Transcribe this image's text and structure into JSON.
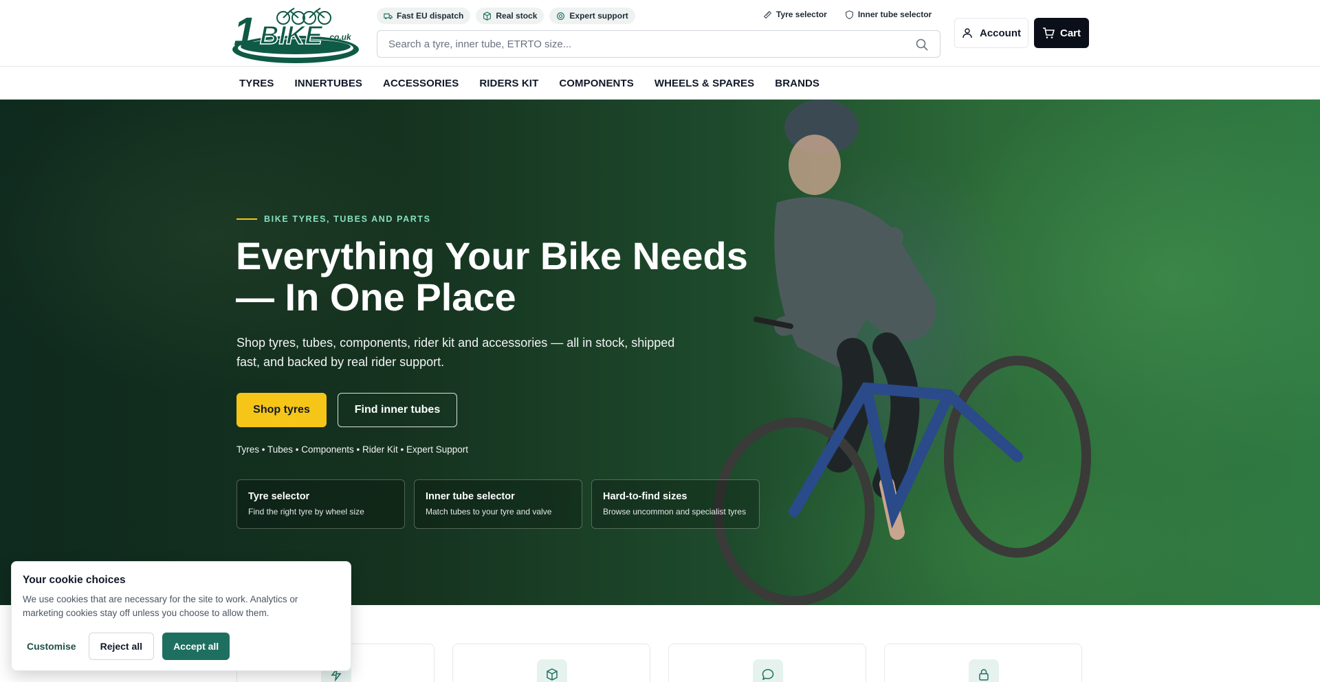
{
  "brand": {
    "logo_text": "1BIKE",
    "logo_suffix": ".co.uk",
    "accent": "#1f6f61",
    "cta_yellow": "#f5c518"
  },
  "badges": [
    {
      "label": "Fast EU dispatch",
      "icon": "truck-icon"
    },
    {
      "label": "Real stock",
      "icon": "box-icon"
    },
    {
      "label": "Expert support",
      "icon": "support-icon"
    }
  ],
  "top_links": [
    {
      "label": "Tyre selector",
      "icon": "ruler-icon"
    },
    {
      "label": "Inner tube selector",
      "icon": "shield-icon"
    }
  ],
  "search": {
    "placeholder": "Search a tyre, inner tube, ETRTO size...",
    "value": ""
  },
  "account": {
    "label": "Account"
  },
  "cart": {
    "label": "Cart"
  },
  "nav": [
    "TYRES",
    "INNERTUBES",
    "ACCESSORIES",
    "RIDERS KIT",
    "COMPONENTS",
    "WHEELS & SPARES",
    "BRANDS"
  ],
  "hero": {
    "eyebrow": "BIKE TYRES, TUBES AND PARTS",
    "title_line1": "Everything Your Bike Needs",
    "title_line2": "— In One Place",
    "subtitle": "Shop tyres, tubes, components, rider kit and accessories — all in stock, shipped fast, and backed by real rider support.",
    "primary_cta": "Shop tyres",
    "secondary_cta": "Find inner tubes",
    "categories": "Tyres • Tubes • Components • Rider Kit • Expert Support",
    "cards": [
      {
        "title": "Tyre selector",
        "desc": "Find the right tyre by wheel size"
      },
      {
        "title": "Inner tube selector",
        "desc": "Match tubes to your tyre and valve"
      },
      {
        "title": "Hard-to-find sizes",
        "desc": "Browse uncommon and specialist tyres"
      }
    ]
  },
  "features": [
    {
      "icon": "lightning-icon"
    },
    {
      "icon": "box-icon"
    },
    {
      "icon": "chat-icon"
    },
    {
      "icon": "lock-icon"
    }
  ],
  "cookie": {
    "title": "Your cookie choices",
    "description": "We use cookies that are necessary for the site to work. Analytics or marketing cookies stay off unless you choose to allow them.",
    "customise": "Customise",
    "reject": "Reject all",
    "accept": "Accept all"
  }
}
